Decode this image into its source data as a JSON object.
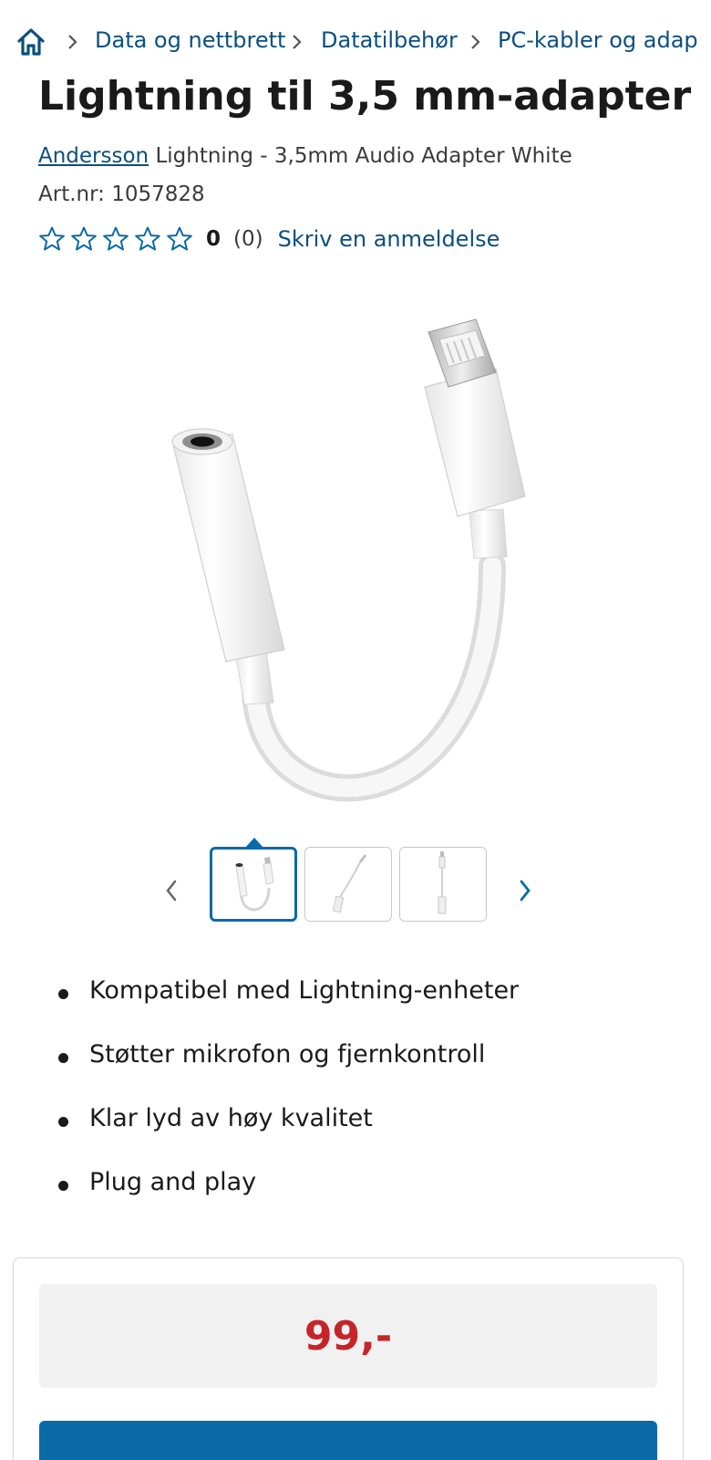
{
  "breadcrumb": {
    "items": [
      "Data og nettbrett",
      "Datatilbehør",
      "PC-kabler og adap"
    ]
  },
  "product": {
    "title": "Lightning til 3,5 mm-adapter",
    "brand": "Andersson",
    "name": "Lightning - 3,5mm Audio Adapter White",
    "artnr": "Art.nr: 1057828",
    "rating": {
      "stars_filled": 0,
      "stars_total": 5,
      "score": "0",
      "count": "(0)",
      "write_review": "Skriv en anmeldelse"
    }
  },
  "gallery": {
    "active_index": 0,
    "thumbnail_count": 3
  },
  "features": [
    "Kompatibel med Lightning-enheter",
    "Støtter mikrofon og fjernkontroll",
    "Klar lyd av høy kvalitet",
    "Plug and play"
  ],
  "buy": {
    "price": "99,-"
  },
  "colors": {
    "link": "#0b4f7e",
    "accent": "#0b6aa8",
    "price": "#c4252a"
  },
  "icons": {
    "home": "home-icon",
    "separator": "chevron-right-icon",
    "star": "star-outline-icon",
    "prev": "chevron-left-icon",
    "next": "chevron-right-icon"
  }
}
